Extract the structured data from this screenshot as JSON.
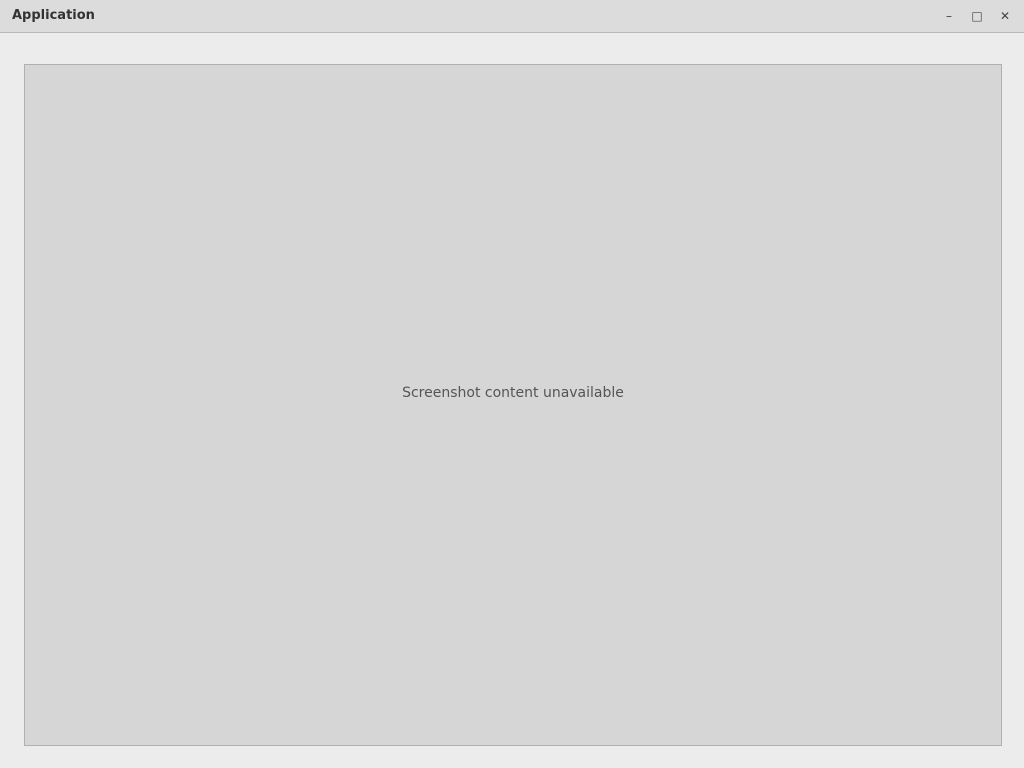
{
  "window": {
    "title": "Application"
  },
  "notice": "Screenshot content unavailable"
}
